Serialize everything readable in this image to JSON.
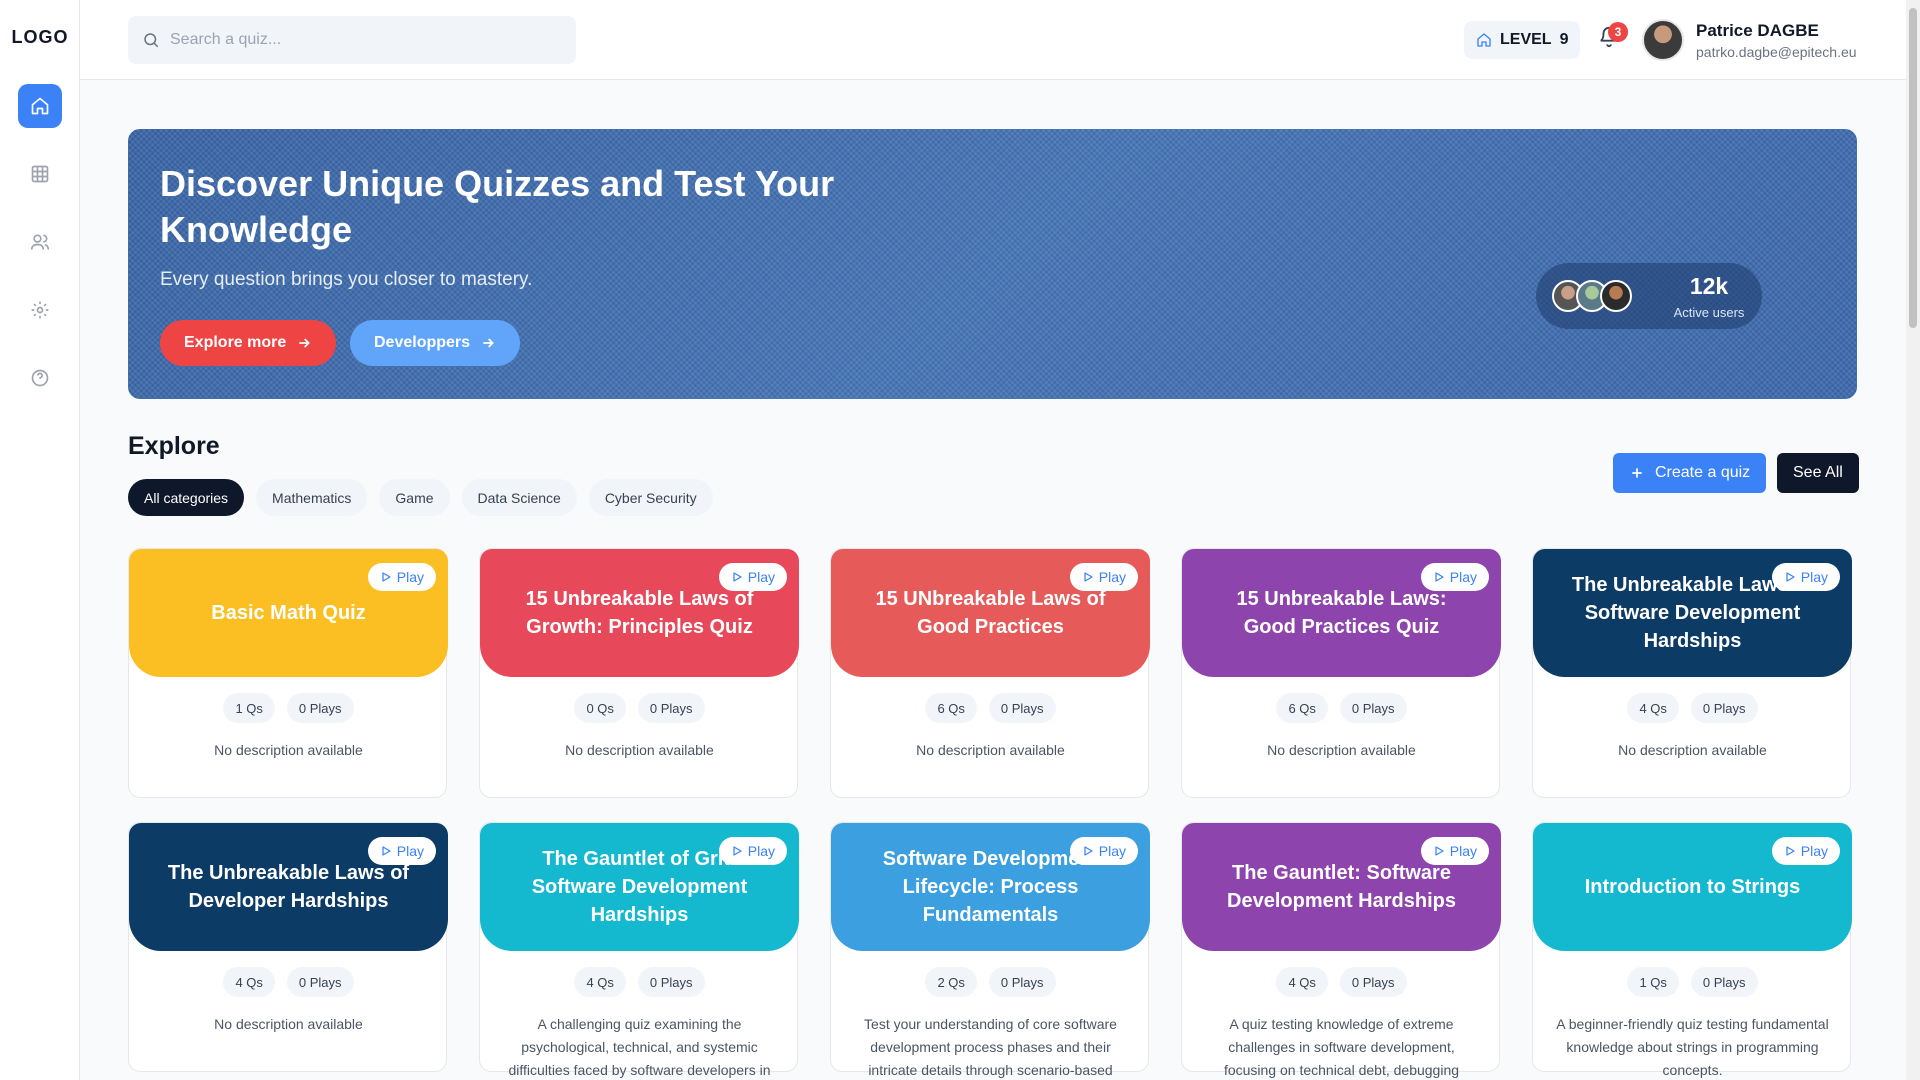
{
  "app": {
    "logo": "LOGO",
    "nav": [
      {
        "name": "home",
        "icon": "home-icon",
        "active": true
      },
      {
        "name": "grid",
        "icon": "grid-icon",
        "active": false
      },
      {
        "name": "users",
        "icon": "users-icon",
        "active": false
      },
      {
        "name": "settings",
        "icon": "gear-icon",
        "active": false
      },
      {
        "name": "help",
        "icon": "help-circle-icon",
        "active": false
      }
    ]
  },
  "header": {
    "search_placeholder": "Search a quiz...",
    "search_value": "",
    "level_label": "LEVEL",
    "level_value": "9",
    "notification_count": "3",
    "user_name": "Patrice DAGBE",
    "user_email": "patrko.dagbe@epitech.eu"
  },
  "hero": {
    "title": "Discover Unique Quizzes and Test Your Knowledge",
    "subtitle": "Every question brings you closer to mastery.",
    "explore_label": "Explore more",
    "developers_label": "Developpers",
    "active_count": "12k",
    "active_label": "Active users"
  },
  "explore": {
    "title": "Explore",
    "categories": [
      "All categories",
      "Mathematics",
      "Game",
      "Data Science",
      "Cyber Security"
    ],
    "active_category": "All categories",
    "create_label": "Create a quiz",
    "see_all_label": "See All"
  },
  "quizzes": [
    {
      "title": "Basic Math Quiz",
      "color": "#fbbf24",
      "qs": "1 Qs",
      "plays": "0 Plays",
      "description": "No description available",
      "play_label": "Play"
    },
    {
      "title": "15 Unbreakable Laws of Growth: Principles Quiz",
      "color": "#e7485a",
      "qs": "0 Qs",
      "plays": "0 Plays",
      "description": "No description available",
      "play_label": "Play"
    },
    {
      "title": "15 UNbreakable Laws of Good Practices",
      "color": "#e65a5a",
      "qs": "6 Qs",
      "plays": "0 Plays",
      "description": "No description available",
      "play_label": "Play"
    },
    {
      "title": "15 Unbreakable Laws: Good Practices Quiz",
      "color": "#8e44ad",
      "qs": "6 Qs",
      "plays": "0 Plays",
      "description": "No description available",
      "play_label": "Play"
    },
    {
      "title": "The Unbreakable Laws of Software Development Hardships",
      "color": "#0c3b66",
      "qs": "4 Qs",
      "plays": "0 Plays",
      "description": "No description available",
      "play_label": "Play"
    },
    {
      "title": "The Unbreakable Laws of Developer Hardships",
      "color": "#0c3b66",
      "qs": "4 Qs",
      "plays": "0 Plays",
      "description": "No description available",
      "play_label": "Play"
    },
    {
      "title": "The Gauntlet of Grit: Software Development Hardships",
      "color": "#14b8cf",
      "qs": "4 Qs",
      "plays": "0 Plays",
      "description": "A challenging quiz examining the psychological, technical, and systemic difficulties faced by software developers in",
      "play_label": "Play"
    },
    {
      "title": "Software Development Lifecycle: Process Fundamentals",
      "color": "#3b9fe0",
      "qs": "2 Qs",
      "plays": "0 Plays",
      "description": "Test your understanding of core software development process phases and their intricate details through scenario-based",
      "play_label": "Play"
    },
    {
      "title": "The Gauntlet: Software Development Hardships",
      "color": "#8e44ad",
      "qs": "4 Qs",
      "plays": "0 Plays",
      "description": "A quiz testing knowledge of extreme challenges in software development, focusing on technical debt, debugging nightmares,",
      "play_label": "Play"
    },
    {
      "title": "Introduction to Strings",
      "color": "#14b8cf",
      "qs": "1 Qs",
      "plays": "0 Plays",
      "description": "A beginner-friendly quiz testing fundamental knowledge about strings in programming concepts.",
      "play_label": "Play"
    }
  ]
}
